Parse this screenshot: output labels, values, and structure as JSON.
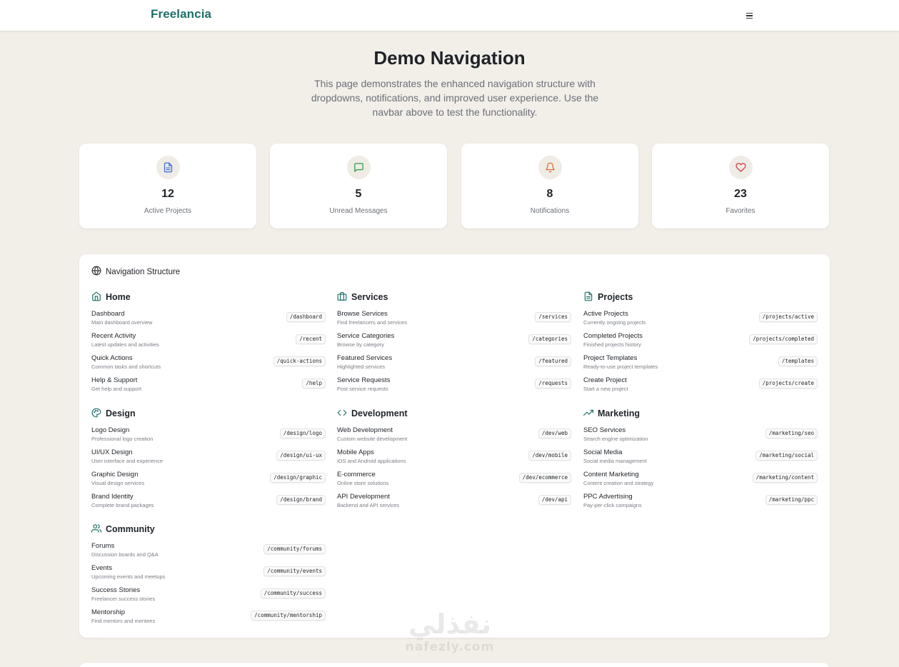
{
  "navbar": {
    "brand": "Freelancia",
    "menu_icon": "hamburger-menu-icon"
  },
  "hero": {
    "title": "Demo Navigation",
    "description": "This page demonstrates the enhanced navigation structure with dropdowns, notifications, and improved user experience. Use the navbar above to test the functionality."
  },
  "stats": [
    {
      "value": "12",
      "label": "Active Projects",
      "icon": "document-icon",
      "color": "#3b6fd8"
    },
    {
      "value": "5",
      "label": "Unread Messages",
      "icon": "message-icon",
      "color": "#2e9a4a"
    },
    {
      "value": "8",
      "label": "Notifications",
      "icon": "bell-icon",
      "color": "#e36a2c"
    },
    {
      "value": "23",
      "label": "Favorites",
      "icon": "heart-icon",
      "color": "#d9363e"
    }
  ],
  "structure": {
    "title": "Navigation Structure",
    "icon": "globe-icon",
    "accent": "#1d6f68",
    "sections": [
      {
        "name": "Home",
        "icon": "home-icon",
        "items": [
          {
            "title": "Dashboard",
            "desc": "Main dashboard overview",
            "path": "/dashboard"
          },
          {
            "title": "Recent Activity",
            "desc": "Latest updates and activities",
            "path": "/recent"
          },
          {
            "title": "Quick Actions",
            "desc": "Common tasks and shortcuts",
            "path": "/quick-actions"
          },
          {
            "title": "Help & Support",
            "desc": "Get help and support",
            "path": "/help"
          }
        ]
      },
      {
        "name": "Services",
        "icon": "briefcase-icon",
        "items": [
          {
            "title": "Browse Services",
            "desc": "Find freelancers and services",
            "path": "/services"
          },
          {
            "title": "Service Categories",
            "desc": "Browse by category",
            "path": "/categories"
          },
          {
            "title": "Featured Services",
            "desc": "Highlighted services",
            "path": "/featured"
          },
          {
            "title": "Service Requests",
            "desc": "Post service requests",
            "path": "/requests"
          }
        ]
      },
      {
        "name": "Projects",
        "icon": "file-icon",
        "items": [
          {
            "title": "Active Projects",
            "desc": "Currently ongoing projects",
            "path": "/projects/active"
          },
          {
            "title": "Completed Projects",
            "desc": "Finished projects history",
            "path": "/projects/completed"
          },
          {
            "title": "Project Templates",
            "desc": "Ready-to-use project templates",
            "path": "/templates"
          },
          {
            "title": "Create Project",
            "desc": "Start a new project",
            "path": "/projects/create"
          }
        ]
      },
      {
        "name": "Design",
        "icon": "palette-icon",
        "items": [
          {
            "title": "Logo Design",
            "desc": "Professional logo creation",
            "path": "/design/logo"
          },
          {
            "title": "UI/UX Design",
            "desc": "User interface and experience",
            "path": "/design/ui-ux"
          },
          {
            "title": "Graphic Design",
            "desc": "Visual design services",
            "path": "/design/graphic"
          },
          {
            "title": "Brand Identity",
            "desc": "Complete brand packages",
            "path": "/design/brand"
          }
        ]
      },
      {
        "name": "Development",
        "icon": "code-icon",
        "items": [
          {
            "title": "Web Development",
            "desc": "Custom website development",
            "path": "/dev/web"
          },
          {
            "title": "Mobile Apps",
            "desc": "iOS and Android applications",
            "path": "/dev/mobile"
          },
          {
            "title": "E-commerce",
            "desc": "Online store solutions",
            "path": "/dev/ecommerce"
          },
          {
            "title": "API Development",
            "desc": "Backend and API services",
            "path": "/dev/api"
          }
        ]
      },
      {
        "name": "Marketing",
        "icon": "trending-up-icon",
        "items": [
          {
            "title": "SEO Services",
            "desc": "Search engine optimization",
            "path": "/marketing/seo"
          },
          {
            "title": "Social Media",
            "desc": "Social media management",
            "path": "/marketing/social"
          },
          {
            "title": "Content Marketing",
            "desc": "Content creation and strategy",
            "path": "/marketing/content"
          },
          {
            "title": "PPC Advertising",
            "desc": "Pay-per-click campaigns",
            "path": "/marketing/ppc"
          }
        ]
      },
      {
        "name": "Community",
        "icon": "users-icon",
        "items": [
          {
            "title": "Forums",
            "desc": "Discussion boards and Q&A",
            "path": "/community/forums"
          },
          {
            "title": "Events",
            "desc": "Upcoming events and meetups",
            "path": "/community/events"
          },
          {
            "title": "Success Stories",
            "desc": "Freelancer success stories",
            "path": "/community/success"
          },
          {
            "title": "Mentorship",
            "desc": "Find mentors and mentees",
            "path": "/community/mentorship"
          }
        ]
      }
    ]
  },
  "watermark": {
    "arabic": "نفذلي",
    "latin": "nafezly.com"
  }
}
